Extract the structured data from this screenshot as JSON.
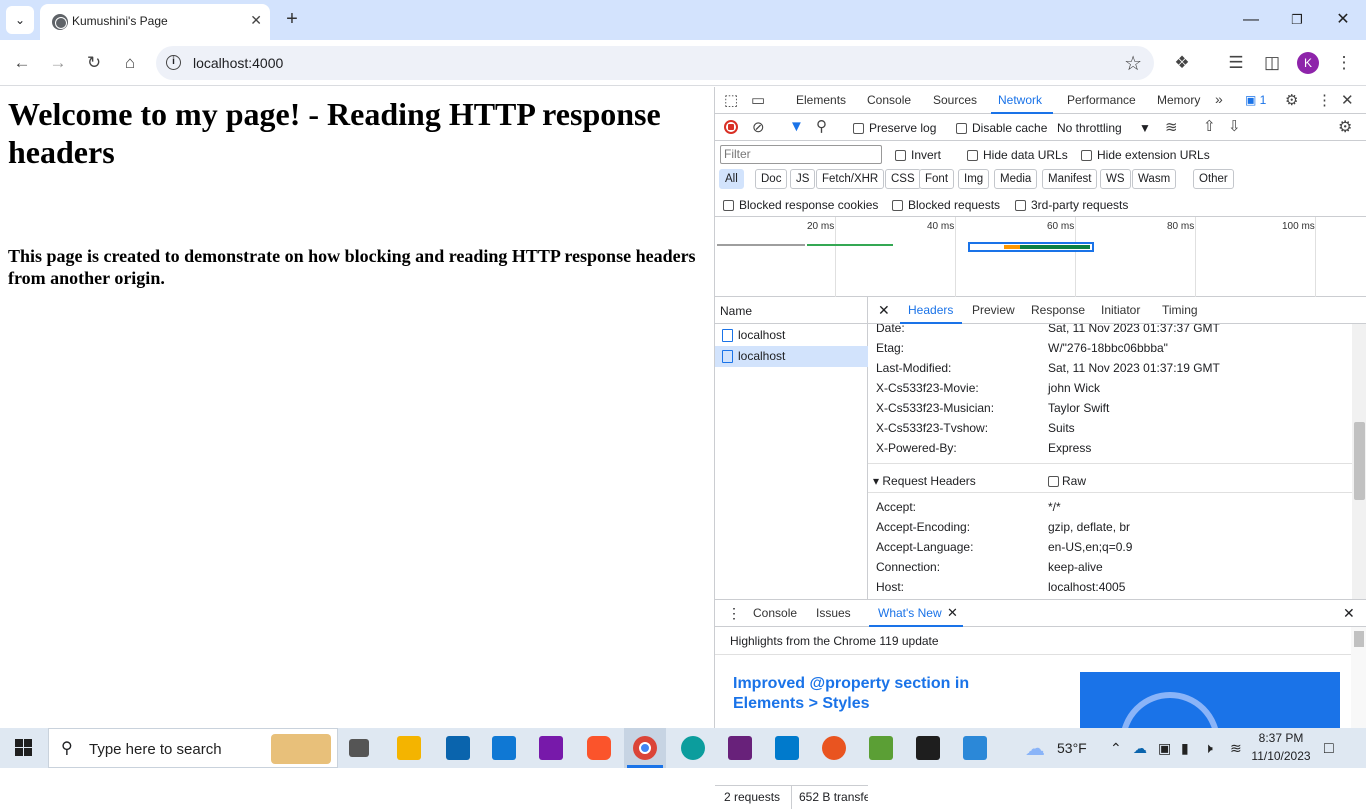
{
  "browser": {
    "tab_title": "Kumushini's Page",
    "url": "localhost:4000",
    "profile_initial": "K"
  },
  "page": {
    "heading": "Welcome to my page! - Reading HTTP response headers",
    "body": "This page is created to demonstrate on how blocking and reading HTTP response headers from another origin."
  },
  "devtools": {
    "tabs": [
      "Elements",
      "Console",
      "Sources",
      "Network",
      "Performance",
      "Memory"
    ],
    "issues_count": "1",
    "toolbar": {
      "preserve_log": "Preserve log",
      "disable_cache": "Disable cache",
      "throttling": "No throttling"
    },
    "filter": {
      "placeholder": "Filter",
      "invert": "Invert",
      "hide_data_urls": "Hide data URLs",
      "hide_extension_urls": "Hide extension URLs"
    },
    "types": [
      "All",
      "Doc",
      "JS",
      "Fetch/XHR",
      "CSS",
      "Font",
      "Img",
      "Media",
      "Manifest",
      "WS",
      "Wasm",
      "Other"
    ],
    "blocked": {
      "cookies": "Blocked response cookies",
      "requests": "Blocked requests",
      "third_party": "3rd-party requests"
    },
    "timeline_labels": [
      "20 ms",
      "40 ms",
      "60 ms",
      "80 ms",
      "100 ms"
    ],
    "requests": {
      "name_header": "Name",
      "items": [
        "localhost",
        "localhost"
      ],
      "summary": "2 requests",
      "transferred": "652 B transfe"
    },
    "detail_tabs": [
      "Headers",
      "Preview",
      "Response",
      "Initiator",
      "Timing"
    ],
    "response_headers": [
      {
        "name": "Date:",
        "value": "Sat, 11 Nov 2023 01:37:37 GMT"
      },
      {
        "name": "Etag:",
        "value": "W/\"276-18bbc06bbba\""
      },
      {
        "name": "Last-Modified:",
        "value": "Sat, 11 Nov 2023 01:37:19 GMT"
      },
      {
        "name": "X-Cs533f23-Movie:",
        "value": "john Wick"
      },
      {
        "name": "X-Cs533f23-Musician:",
        "value": "Taylor Swift"
      },
      {
        "name": "X-Cs533f23-Tvshow:",
        "value": "Suits"
      },
      {
        "name": "X-Powered-By:",
        "value": "Express"
      }
    ],
    "request_headers_title": "Request Headers",
    "raw_label": "Raw",
    "request_headers": [
      {
        "name": "Accept:",
        "value": "*/*"
      },
      {
        "name": "Accept-Encoding:",
        "value": "gzip, deflate, br"
      },
      {
        "name": "Accept-Language:",
        "value": "en-US,en;q=0.9"
      },
      {
        "name": "Connection:",
        "value": "keep-alive"
      },
      {
        "name": "Host:",
        "value": "localhost:4005"
      }
    ],
    "drawer": {
      "tabs": [
        "Console",
        "Issues",
        "What's New"
      ],
      "highlights": "Highlights from the Chrome 119 update",
      "feature_title": "Improved @property section in Elements > Styles"
    }
  },
  "taskbar": {
    "search_placeholder": "Type here to search",
    "weather": "53°F",
    "time": "8:37 PM",
    "date": "11/10/2023"
  },
  "colors": {
    "titlebar": "#d3e3fd",
    "accent": "#1a73e8",
    "taskbar": "#dfe8f2"
  }
}
